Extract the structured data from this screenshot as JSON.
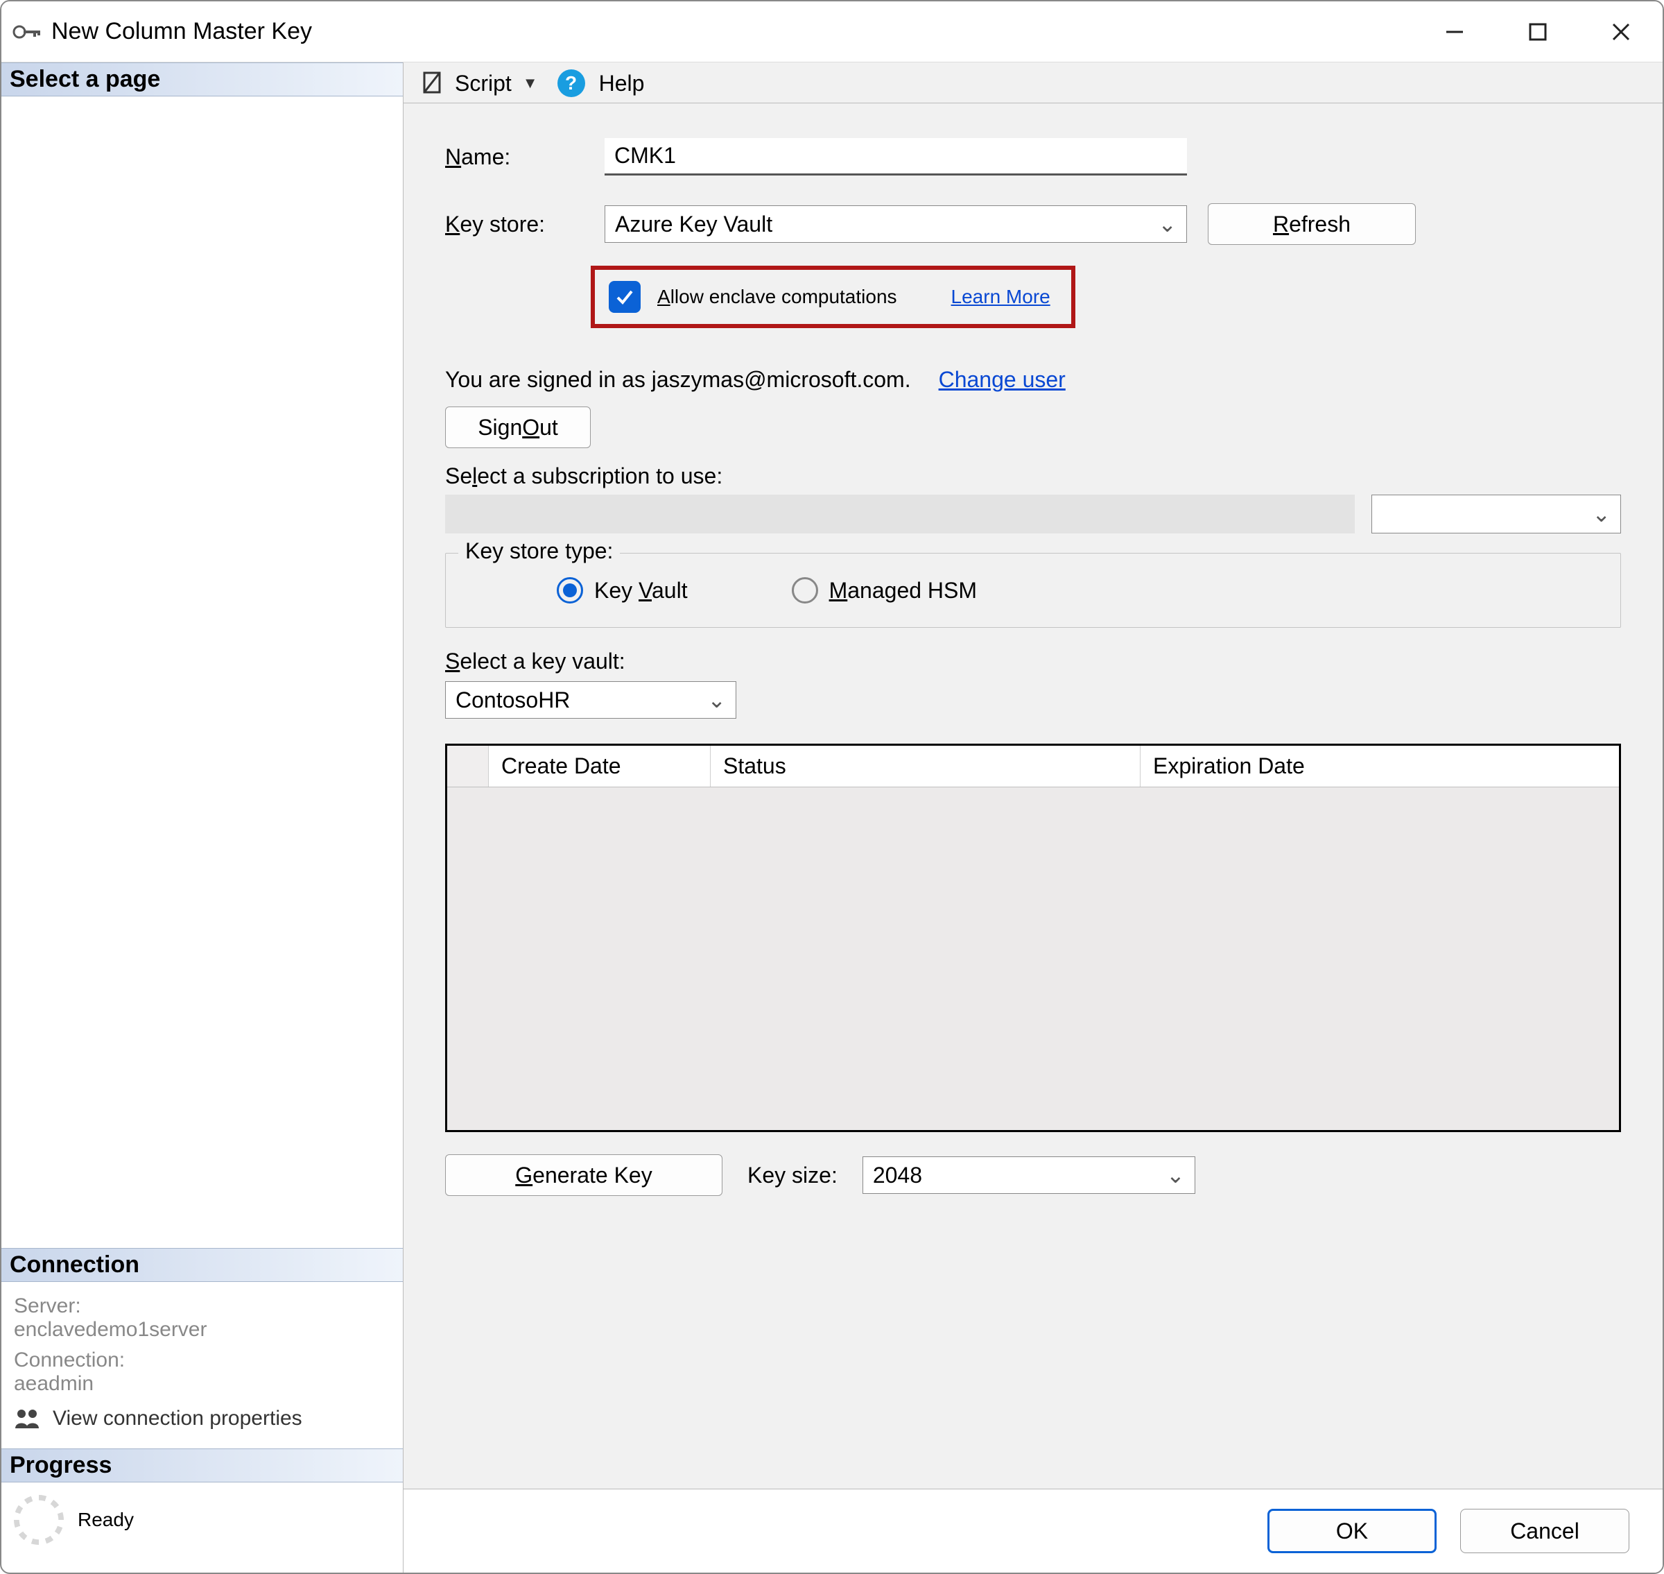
{
  "window": {
    "title": "New Column Master Key"
  },
  "sidebar": {
    "select_page": "Select a page",
    "connection_header": "Connection",
    "server_label": "Server:",
    "server_value": "enclavedemo1server",
    "connection_label": "Connection:",
    "connection_value": "aeadmin",
    "view_props": "View connection properties",
    "progress_header": "Progress",
    "progress_status": "Ready"
  },
  "toolbar": {
    "script": "Script",
    "help": "Help"
  },
  "form": {
    "name_label": "Name:",
    "name_value": "CMK1",
    "keystore_label": "Key store:",
    "keystore_value": "Azure Key Vault",
    "refresh": "Refresh",
    "allow_enclave": "Allow enclave computations",
    "learn_more": "Learn More",
    "signed_in": "You are signed in as jaszymas@microsoft.com.",
    "change_user": "Change user",
    "sign_out": "Sign Out",
    "select_subscription": "Select a subscription to use:",
    "keystore_type": "Key store type:",
    "radio_vault": "Key Vault",
    "radio_hsm": "Managed HSM",
    "select_keyvault": "Select a key vault:",
    "keyvault_value": "ContosoHR",
    "columns": {
      "c1": "Create Date",
      "c2": "Status",
      "c3": "Expiration Date"
    },
    "generate_key": "Generate Key",
    "keysize_label": "Key size:",
    "keysize_value": "2048"
  },
  "footer": {
    "ok": "OK",
    "cancel": "Cancel"
  }
}
